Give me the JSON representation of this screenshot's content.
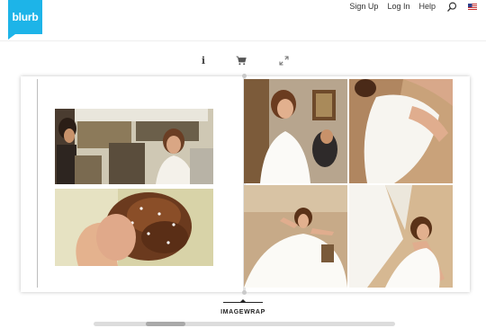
{
  "header": {
    "logo_text": "blurb",
    "nav": {
      "signup": "Sign Up",
      "login": "Log In",
      "help": "Help"
    },
    "search_icon": "search-icon",
    "flag_icon": "us-flag-icon"
  },
  "toolbar": {
    "info_glyph": "i",
    "info_icon": "info-icon",
    "cart_icon": "cart-icon",
    "expand_icon": "expand-icon"
  },
  "book": {
    "layout_name": "IMAGEWRAP",
    "photos": [
      "photo-bride-makeup",
      "photo-bride-hair-closeup",
      "photo-bride-portrait",
      "photo-dress-closeup",
      "photo-bride-lifting-dress",
      "photo-dress-swirl"
    ]
  },
  "colors": {
    "brand": "#1db4e8",
    "text": "#333333",
    "scroll_track": "#dcdcdc",
    "scroll_thumb": "#a9a9a9"
  }
}
